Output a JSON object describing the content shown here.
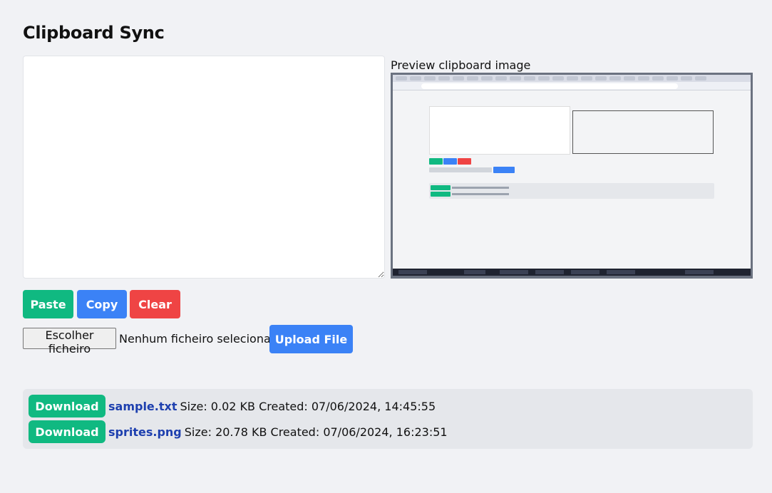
{
  "app": {
    "title": "Clipboard Sync"
  },
  "editor": {
    "value": ""
  },
  "preview": {
    "label": "Preview clipboard image"
  },
  "actions": {
    "paste": "Paste",
    "copy": "Copy",
    "clear": "Clear"
  },
  "upload": {
    "choose_label": "Escolher ficheiro",
    "status": "Nenhum ficheiro selecionado",
    "button": "Upload File"
  },
  "files": [
    {
      "download": "Download",
      "name": "sample.txt",
      "meta": "Size: 0.02 KB Created: 07/06/2024, 14:45:55"
    },
    {
      "download": "Download",
      "name": "sprites.png",
      "meta": "Size: 20.78 KB Created: 07/06/2024, 16:23:51"
    }
  ],
  "colors": {
    "paste": "#10b981",
    "copy": "#3b82f6",
    "clear": "#ef4444",
    "upload": "#3b82f6",
    "download": "#10b981",
    "filename": "#1e40af",
    "background": "#f1f2f5",
    "files_panel": "#e5e7eb"
  }
}
